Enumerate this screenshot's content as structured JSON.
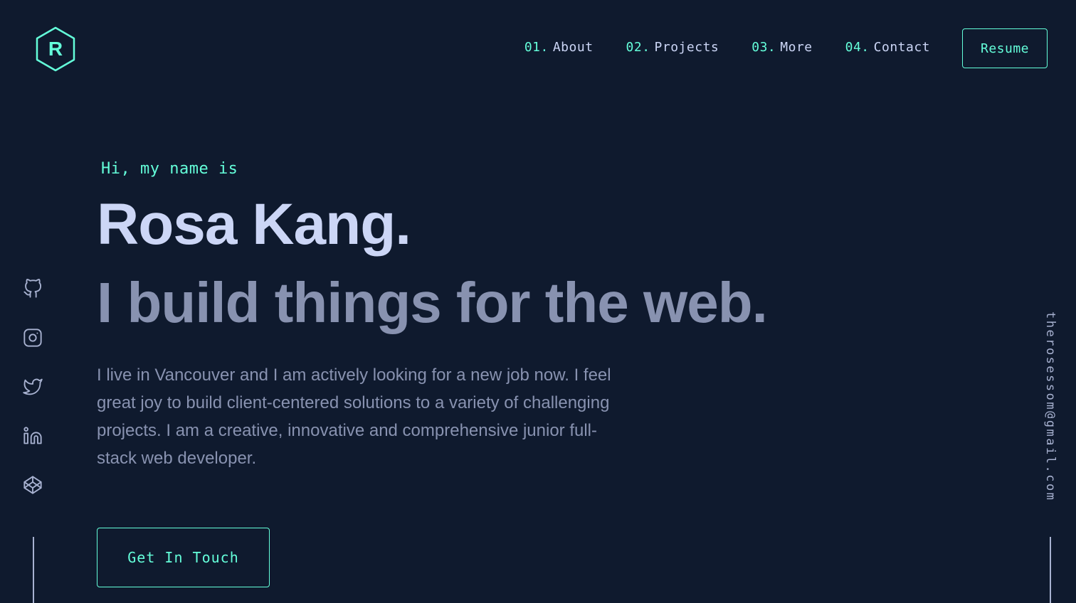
{
  "colors": {
    "background": "#0f1a2e",
    "accent": "#64ffda",
    "heading": "#ccd6f6",
    "text": "#8892b0"
  },
  "logo": {
    "letter": "R",
    "icon": "hexagon-logo-icon"
  },
  "nav": {
    "items": [
      {
        "num": "01.",
        "label": "About"
      },
      {
        "num": "02.",
        "label": "Projects"
      },
      {
        "num": "03.",
        "label": "More"
      },
      {
        "num": "04.",
        "label": "Contact"
      }
    ],
    "resume_label": "Resume"
  },
  "hero": {
    "greeting": "Hi, my name is",
    "name": "Rosa Kang.",
    "tagline": "I build things for the web.",
    "bio": "I live in Vancouver and I am actively looking for a new job now. I feel great joy to build client-centered solutions to a variety of challenging projects. I am a creative, innovative and comprehensive junior full-stack web developer.",
    "cta_label": "Get In Touch"
  },
  "social": {
    "icons": [
      "github-icon",
      "instagram-icon",
      "twitter-icon",
      "linkedin-icon",
      "codepen-icon"
    ]
  },
  "email": "therosessom@gmail.com"
}
